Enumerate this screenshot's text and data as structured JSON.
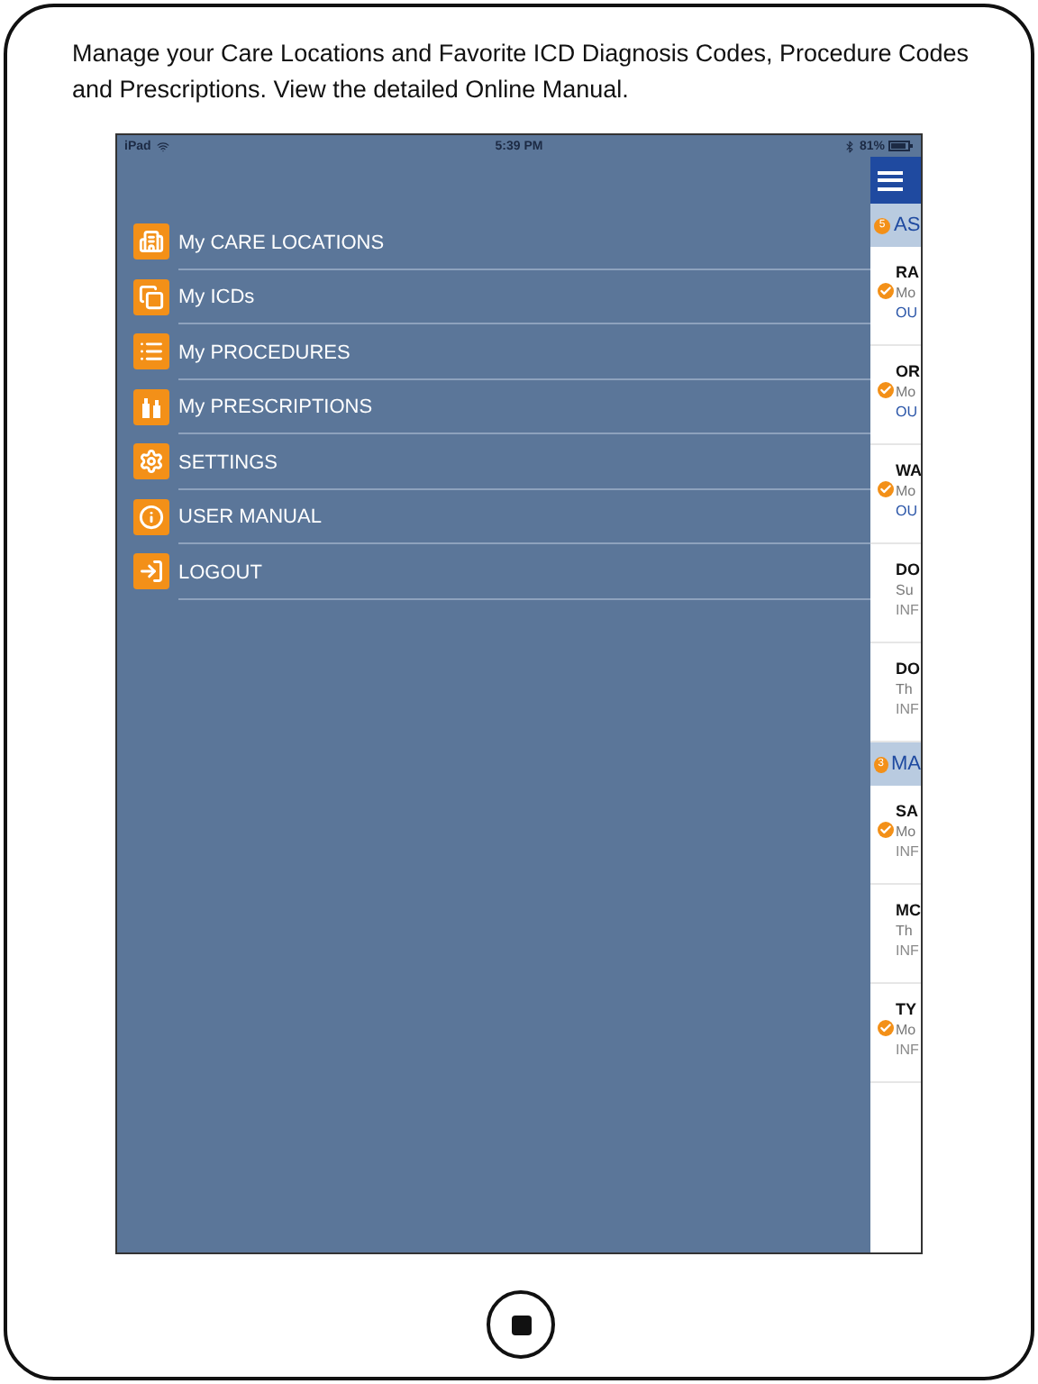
{
  "caption": "Manage your Care Locations and Favorite ICD Diagnosis Codes, Procedure Codes and Prescriptions. View the detailed Online Manual.",
  "status_bar": {
    "device": "iPad",
    "time": "5:39 PM",
    "battery": "81%"
  },
  "menu": [
    {
      "label": "My CARE LOCATIONS",
      "kind": "building"
    },
    {
      "label": "My ICDs",
      "kind": "document"
    },
    {
      "label": "My PROCEDURES",
      "kind": "list"
    },
    {
      "label": "My PRESCRIPTIONS",
      "kind": "bottles"
    },
    {
      "label": "SETTINGS",
      "kind": "gear"
    },
    {
      "label": "USER MANUAL",
      "kind": "info"
    },
    {
      "label": "LOGOUT",
      "kind": "logout"
    }
  ],
  "list_panel": {
    "sections": [
      {
        "badge": "5",
        "title": "AS",
        "rows": [
          {
            "title": "RA",
            "line_2": "Mo",
            "line_3": "OU",
            "checked": true,
            "color": "#2a55a8"
          },
          {
            "title": "OR",
            "line_2": "Mo",
            "line_3": "OU",
            "checked": true,
            "color": "#2a55a8"
          },
          {
            "title": "WA",
            "line_2": "Mo",
            "line_3": "OU",
            "checked": true,
            "color": "#2a55a8"
          },
          {
            "title": "DO",
            "line_2": "Su",
            "line_3": "INF",
            "checked": false,
            "color": "#8a8a8a"
          },
          {
            "title": "DO",
            "line_2": "Th",
            "line_3": "INF",
            "checked": false,
            "color": "#8a8a8a"
          }
        ]
      },
      {
        "badge": "3",
        "title": "MA",
        "rows": [
          {
            "title": "SA",
            "line_2": "Mo",
            "line_3": "INF",
            "checked": true,
            "color": "#8a8a8a"
          },
          {
            "title": "MC",
            "line_2": "Th",
            "line_3": "INF",
            "checked": false,
            "color": "#8a8a8a"
          },
          {
            "title": "TY",
            "line_2": "Mo",
            "line_3": "INF",
            "checked": true,
            "color": "#8a8a8a"
          }
        ]
      }
    ]
  }
}
